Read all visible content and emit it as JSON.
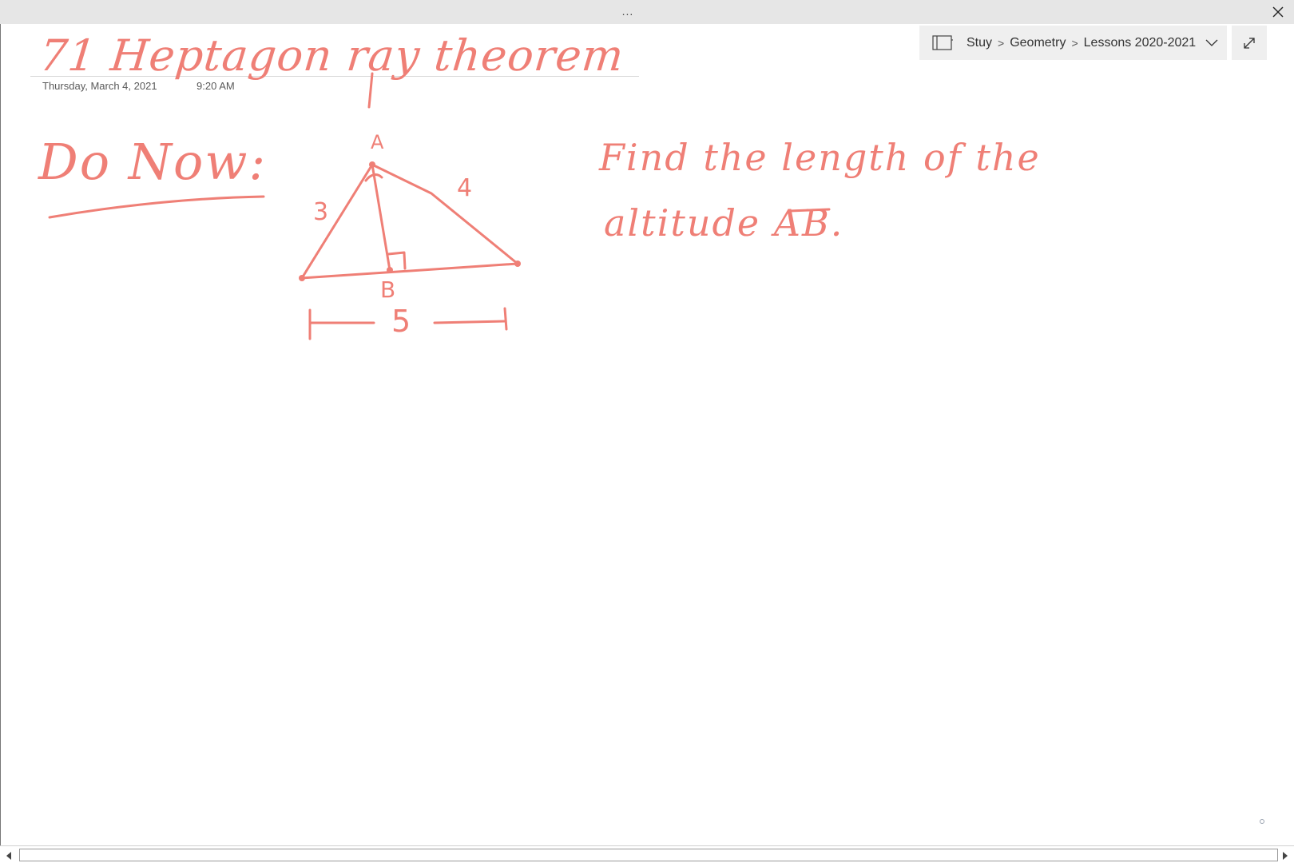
{
  "window": {
    "menu_dots": "...",
    "close_icon": "close-icon"
  },
  "breadcrumb": {
    "notebook_icon": "notebook-icon",
    "items": [
      "Stuy",
      "Geometry",
      "Lessons 2020-2021"
    ],
    "separator": ">",
    "dropdown_icon": "chevron-down-icon"
  },
  "expand_icon": "expand-icon",
  "page": {
    "title": "71 Heptagon ray theorem",
    "date": "Thursday, March 4, 2021",
    "time": "9:20 AM"
  },
  "ink": {
    "do_now": "Do Now:",
    "question_line1": "Find the length of the",
    "question_line2": "altitude AB.",
    "diagram": {
      "vertex_a": "A",
      "vertex_b": "B",
      "side_left": "3",
      "side_right": "4",
      "base": "5"
    }
  },
  "colors": {
    "ink": "#ef7f76",
    "title_bar": "#e6e6e6",
    "breadcrumb_bg": "#efefef"
  }
}
